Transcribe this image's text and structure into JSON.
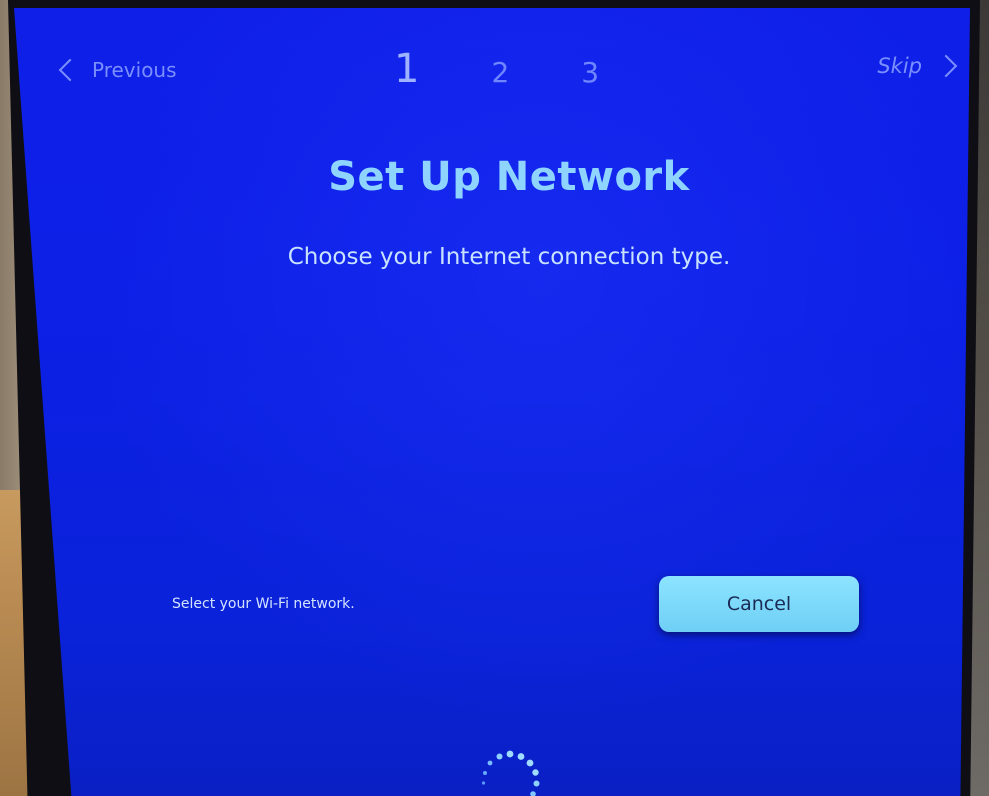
{
  "header": {
    "previous_label": "Previous",
    "steps": [
      "1",
      "2",
      "3"
    ],
    "active_step": "1",
    "skip_label": "Skip"
  },
  "main": {
    "title": "Set Up Network",
    "subtitle": "Choose your Internet connection type."
  },
  "footer": {
    "status_text": "Select your Wi-Fi network.",
    "cancel_label": "Cancel"
  },
  "colors": {
    "screen_blue": "#0c20e6",
    "title_cyan": "#8fd4ff",
    "button_cyan": "#7ad8fa",
    "nav_text": "#7a8fff"
  },
  "icons": {
    "previous": "chevron-left-icon",
    "skip": "chevron-right-icon",
    "loading": "loading-spinner-icon"
  }
}
